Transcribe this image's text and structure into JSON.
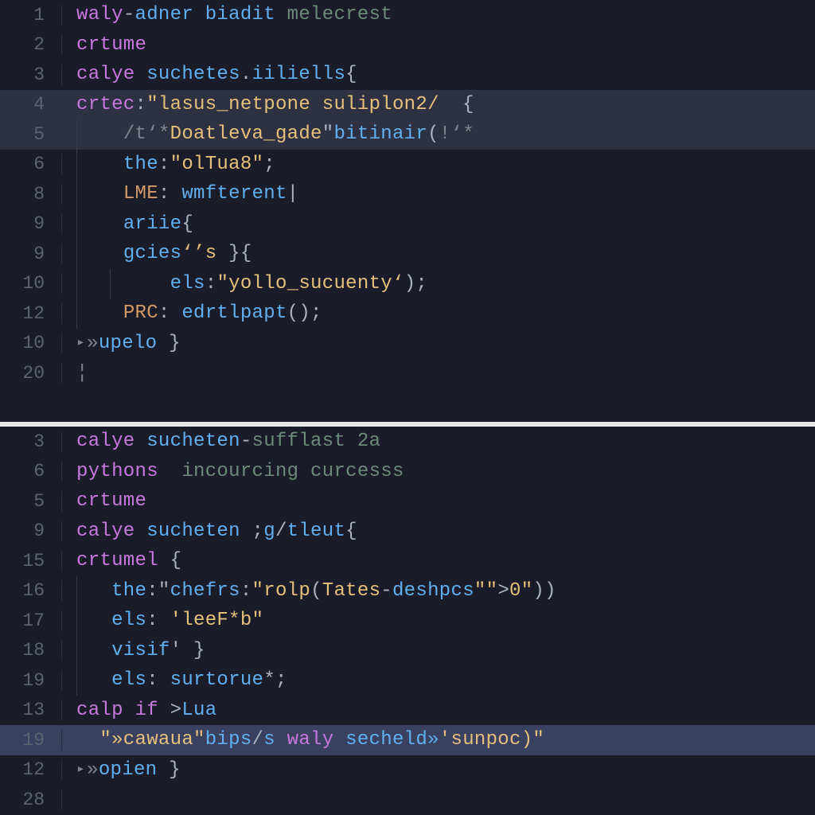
{
  "panes": [
    {
      "id": "top",
      "lines": [
        {
          "num": "1",
          "hl": false,
          "tokens": [
            [
              "k",
              "waly"
            ],
            [
              "p",
              "-"
            ],
            [
              "fn",
              "adner "
            ],
            [
              "fn",
              "biadit "
            ],
            [
              "c2",
              "melecrest"
            ]
          ]
        },
        {
          "num": "2",
          "hl": false,
          "tokens": [
            [
              "k",
              "crtume"
            ]
          ]
        },
        {
          "num": "3",
          "hl": false,
          "tokens": [
            [
              "k",
              "calye "
            ],
            [
              "fn",
              "suchetes"
            ],
            [
              "p",
              "."
            ],
            [
              "fn",
              "iiliells"
            ],
            [
              "p",
              "{"
            ]
          ]
        },
        {
          "num": "4",
          "hl": true,
          "tokens": [
            [
              "k",
              "crtec"
            ],
            [
              "p",
              ":"
            ],
            [
              "s",
              "\"lasus_netpone suliplon2/"
            ],
            [
              "p",
              "  {"
            ]
          ]
        },
        {
          "num": "5",
          "hl": true,
          "guides": [
            1
          ],
          "tokens": [
            [
              "w",
              "    "
            ],
            [
              "c",
              "/t‘*"
            ],
            [
              "s",
              "Doatleva_gade"
            ],
            [
              "p",
              "\""
            ],
            [
              "fn",
              "bitinair"
            ],
            [
              "p",
              "("
            ],
            [
              "c",
              "!‘*"
            ]
          ]
        },
        {
          "num": "6",
          "hl": false,
          "guides": [
            1
          ],
          "tokens": [
            [
              "w",
              "    "
            ],
            [
              "fn",
              "the"
            ],
            [
              "p",
              ":"
            ],
            [
              "s",
              "\"olTua8\""
            ],
            [
              "p",
              ";"
            ]
          ]
        },
        {
          "num": "8",
          "hl": false,
          "guides": [
            1
          ],
          "tokens": [
            [
              "w",
              "    "
            ],
            [
              "id",
              "LME"
            ],
            [
              "p",
              ": "
            ],
            [
              "fn",
              "wmfterent"
            ],
            [
              "p",
              "|"
            ]
          ]
        },
        {
          "num": "9",
          "hl": false,
          "guides": [
            1
          ],
          "tokens": [
            [
              "w",
              "    "
            ],
            [
              "fn",
              "ariie"
            ],
            [
              "p",
              "{"
            ]
          ]
        },
        {
          "num": "9",
          "hl": false,
          "guides": [
            1
          ],
          "tokens": [
            [
              "w",
              "    "
            ],
            [
              "fn",
              "gcies"
            ],
            [
              "s",
              "‘’s"
            ],
            [
              "p",
              " }{ "
            ]
          ]
        },
        {
          "num": "10",
          "hl": false,
          "guides": [
            1,
            2
          ],
          "tokens": [
            [
              "w",
              "        "
            ],
            [
              "fn",
              "els"
            ],
            [
              "p",
              ":"
            ],
            [
              "s",
              "\"yollo_sucuenty‘"
            ],
            [
              "p",
              ");"
            ]
          ]
        },
        {
          "num": "12",
          "hl": false,
          "guides": [
            1
          ],
          "tokens": [
            [
              "w",
              "    "
            ],
            [
              "id",
              "PRC"
            ],
            [
              "p",
              ": "
            ],
            [
              "fn",
              "edrtlpapt"
            ],
            [
              "p",
              "();"
            ]
          ]
        },
        {
          "num": "10",
          "hl": false,
          "tokens": [
            [
              "c",
              "»"
            ],
            [
              "fn",
              "upelo "
            ],
            [
              "p",
              "}"
            ]
          ],
          "cursor": true
        },
        {
          "num": "20",
          "hl": false,
          "tokens": [
            [
              "c",
              "¦"
            ]
          ]
        }
      ]
    },
    {
      "id": "bottom",
      "lines": [
        {
          "num": "3",
          "hl": false,
          "tokens": [
            [
              "k",
              "calye "
            ],
            [
              "fn",
              "sucheten"
            ],
            [
              "p",
              "-"
            ],
            [
              "c2",
              "sufflast 2a"
            ]
          ]
        },
        {
          "num": "6",
          "hl": false,
          "tokens": [
            [
              "k",
              "pythons  "
            ],
            [
              "c2",
              "incourcing curcesss"
            ]
          ]
        },
        {
          "num": "5",
          "hl": false,
          "tokens": [
            [
              "k",
              "crtume"
            ]
          ]
        },
        {
          "num": "9",
          "hl": false,
          "tokens": [
            [
              "k",
              "calye "
            ],
            [
              "fn",
              "sucheten "
            ],
            [
              "p",
              ";"
            ],
            [
              "fn",
              "g"
            ],
            [
              "p",
              "/"
            ],
            [
              "fn",
              "tleut"
            ],
            [
              "p",
              "{"
            ]
          ]
        },
        {
          "num": "15",
          "hl": false,
          "tokens": [
            [
              "k",
              "crtumel "
            ],
            [
              "p",
              "{"
            ]
          ]
        },
        {
          "num": "16",
          "hl": false,
          "guides": [
            1
          ],
          "tokens": [
            [
              "w",
              "   "
            ],
            [
              "fn",
              "the"
            ],
            [
              "p",
              ":\""
            ],
            [
              "fn",
              "chefrs"
            ],
            [
              "p",
              ":"
            ],
            [
              "s",
              "\"rolp"
            ],
            [
              "p",
              "("
            ],
            [
              "s",
              "Tates"
            ],
            [
              "p",
              "-"
            ],
            [
              "fn",
              "deshpcs"
            ],
            [
              "s",
              "\"\""
            ],
            [
              "p",
              ">"
            ],
            [
              "s",
              "0\""
            ],
            [
              "p",
              "))"
            ]
          ]
        },
        {
          "num": "17",
          "hl": false,
          "guides": [
            1
          ],
          "tokens": [
            [
              "w",
              "   "
            ],
            [
              "fn",
              "els"
            ],
            [
              "p",
              ": "
            ],
            [
              "s",
              "'leeF*b\""
            ]
          ]
        },
        {
          "num": "18",
          "hl": false,
          "guides": [
            1
          ],
          "tokens": [
            [
              "w",
              "   "
            ],
            [
              "fn",
              "visif"
            ],
            [
              "p",
              "' }"
            ]
          ]
        },
        {
          "num": "19",
          "hl": false,
          "guides": [
            1
          ],
          "tokens": [
            [
              "w",
              "   "
            ],
            [
              "fn",
              "els"
            ],
            [
              "p",
              ": "
            ],
            [
              "fn",
              "surtorue"
            ],
            [
              "p",
              "*; "
            ]
          ]
        },
        {
          "num": "13",
          "hl": false,
          "tokens": [
            [
              "k",
              "calp "
            ],
            [
              "k",
              "if "
            ],
            [
              "p",
              ">"
            ],
            [
              "fn",
              "Lua"
            ]
          ]
        },
        {
          "num": "19",
          "hl": false,
          "sel": true,
          "tokens": [
            [
              "w",
              "  "
            ],
            [
              "s",
              "\"»cawaua\""
            ],
            [
              "fn",
              "bips"
            ],
            [
              "p",
              "/"
            ],
            [
              "fn",
              "s "
            ],
            [
              "k",
              "waly "
            ],
            [
              "fn",
              "secheld»"
            ],
            [
              "s",
              "'sunpoc)\""
            ]
          ]
        },
        {
          "num": "12",
          "hl": false,
          "tokens": [
            [
              "c",
              "»"
            ],
            [
              "fn",
              "opien "
            ],
            [
              "p",
              "}"
            ]
          ],
          "cursor": true
        },
        {
          "num": "28",
          "hl": false,
          "tokens": []
        }
      ]
    }
  ]
}
